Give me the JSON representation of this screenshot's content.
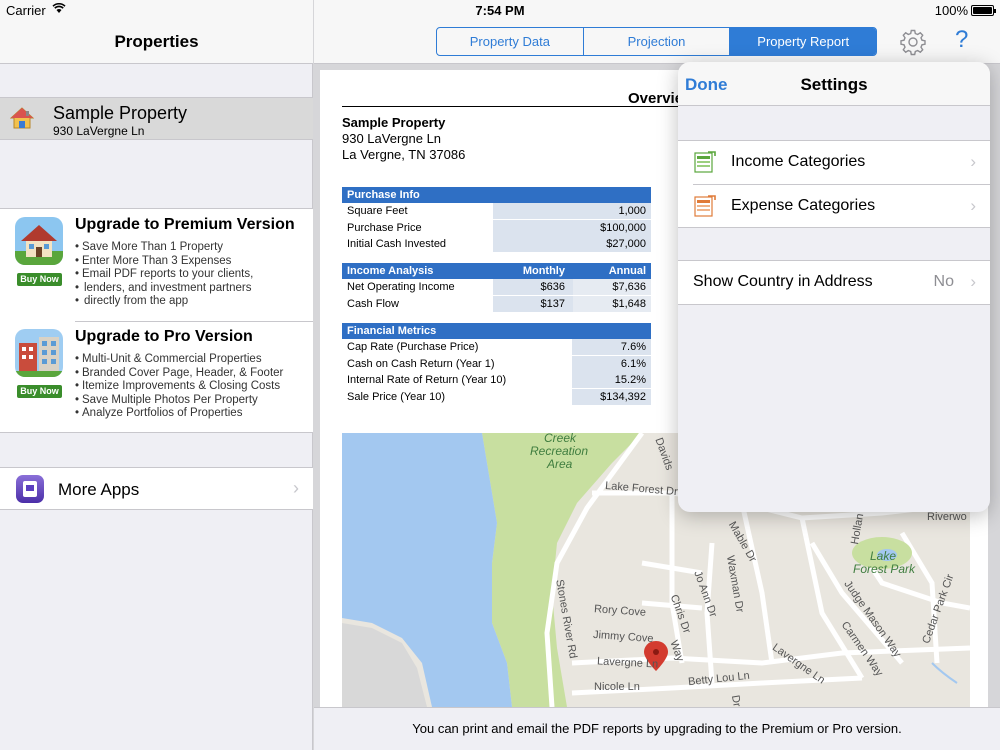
{
  "status_bar": {
    "carrier": "Carrier",
    "time": "7:54 PM",
    "battery": "100%"
  },
  "left": {
    "title": "Properties",
    "property": {
      "name": "Sample Property",
      "address": "930 LaVergne Ln"
    },
    "premium": {
      "title": "Upgrade to Premium Version",
      "buy": "Buy Now",
      "features": [
        "Save More Than 1 Property",
        "Enter More Than 3 Expenses",
        "Email PDF reports to your clients,",
        "lenders, and investment partners",
        "directly from the app"
      ]
    },
    "pro": {
      "title": "Upgrade to Pro Version",
      "buy": "Buy Now",
      "features": [
        "Multi-Unit & Commercial Properties",
        "Branded Cover Page, Header, & Footer",
        "Itemize Improvements & Closing Costs",
        "Save Multiple Photos Per Property",
        "Analyze Portfolios of Properties"
      ]
    },
    "more_apps": "More Apps"
  },
  "right": {
    "segments": [
      "Property Data",
      "Projection",
      "Property Report"
    ],
    "active_segment": "Property Report",
    "help": "?",
    "footer": "You can print and email the PDF reports by upgrading to the Premium or Pro version."
  },
  "report": {
    "title": "Overvie",
    "name": "Sample Property",
    "address1": "930 LaVergne Ln",
    "address2": "La Vergne, TN 37086",
    "purchase": {
      "header": "Purchase Info",
      "rows": [
        {
          "label": "Square Feet",
          "value": "1,000"
        },
        {
          "label": "Purchase Price",
          "value": "$100,000"
        },
        {
          "label": "Initial Cash Invested",
          "value": "$27,000"
        }
      ]
    },
    "income": {
      "header": "Income Analysis",
      "col1": "Monthly",
      "col2": "Annual",
      "rows": [
        {
          "label": "Net Operating Income",
          "monthly": "$636",
          "annual": "$7,636"
        },
        {
          "label": "Cash Flow",
          "monthly": "$137",
          "annual": "$1,648"
        }
      ]
    },
    "metrics": {
      "header": "Financial Metrics",
      "rows": [
        {
          "label": "Cap Rate (Purchase Price)",
          "value": "7.6%"
        },
        {
          "label": "Cash on Cash Return (Year 1)",
          "value": "6.1%"
        },
        {
          "label": "Internal Rate of Return (Year 10)",
          "value": "15.2%"
        },
        {
          "label": "Sale Price (Year 10)",
          "value": "$134,392"
        }
      ]
    },
    "map_labels": {
      "creek": "Creek",
      "recreation": "Recreation",
      "area": "Area",
      "lake_forest_dr": "Lake Forest Dr",
      "lake": "Lake",
      "forest_park": "Forest Park",
      "stones_river_rd": "Stones River Rd",
      "rory_cove": "Rory Cove",
      "jimmy_cove": "Jimmy Cove",
      "lavergne_ln": "Lavergne Ln",
      "lavergne_ln2": "Lavergne Ln",
      "nicole_ln": "Nicole Ln",
      "betty_lou_ln": "Betty Lou Ln",
      "chris_dr": "Chris Dr",
      "jo_ann_dr": "Jo Ann Dr",
      "waxman_dr": "Waxman Dr",
      "mable_dr": "Mable Dr",
      "judge_mason_way": "Judge Mason Way",
      "carmen_way": "Carmen Way",
      "cedar_park_cir": "Cedar Park Cir",
      "davids": "Davids",
      "holland": "Hollan",
      "riverwo": "Riverwo",
      "dr": "Dr",
      "way": "Way"
    }
  },
  "settings": {
    "done": "Done",
    "title": "Settings",
    "income_categories": "Income Categories",
    "expense_categories": "Expense Categories",
    "show_country": "Show Country in Address",
    "show_country_value": "No"
  }
}
